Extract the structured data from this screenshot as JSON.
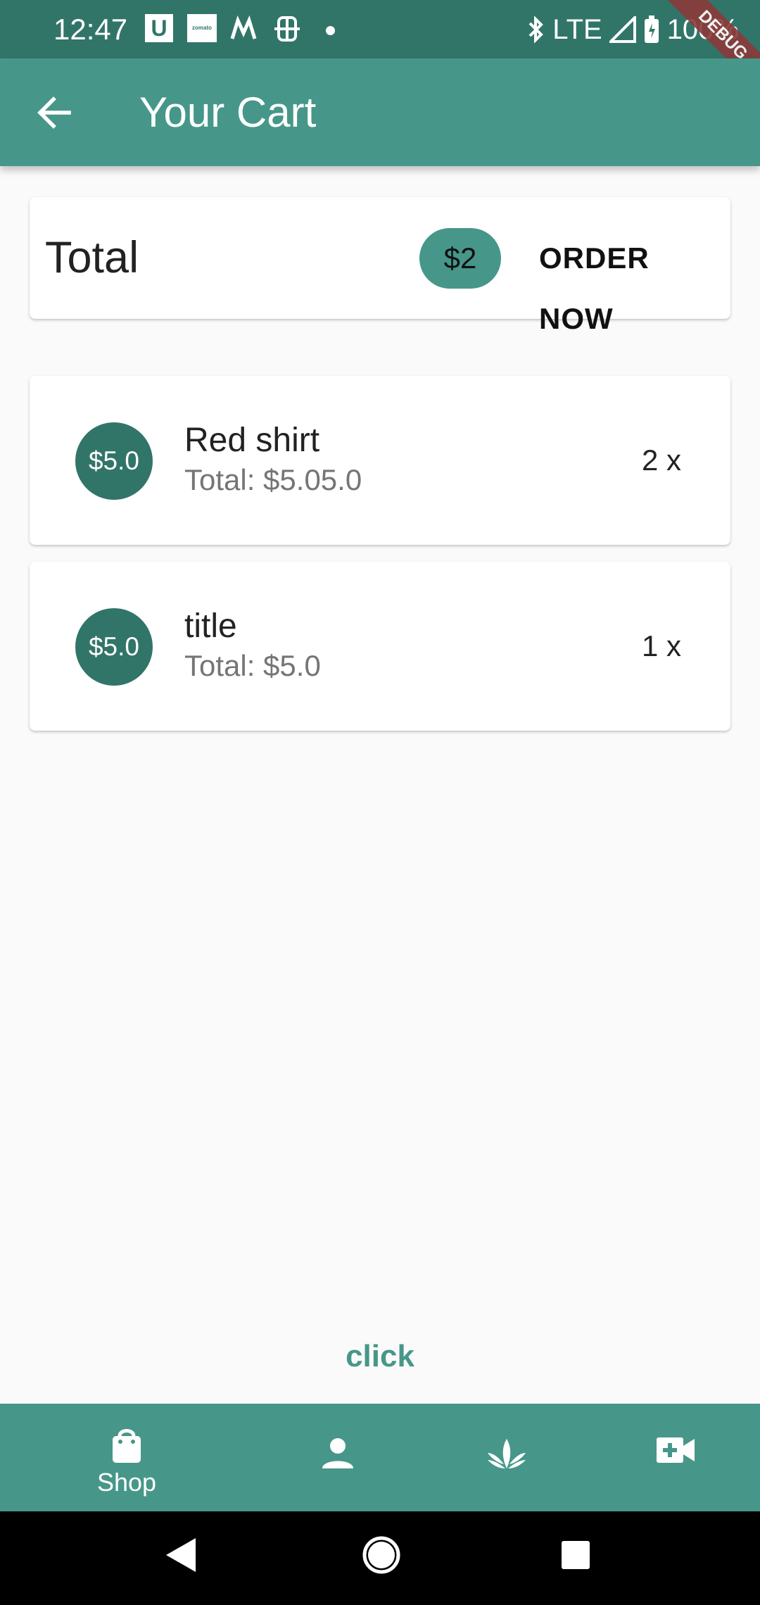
{
  "status_bar": {
    "time": "12:47",
    "network": "LTE",
    "battery": "100%",
    "debug_banner": "DEBUG",
    "notif_u": "U",
    "notif_zomato": "zomato"
  },
  "app_bar": {
    "title": "Your Cart",
    "back_icon": "arrow-back-icon"
  },
  "total_card": {
    "label": "Total",
    "amount": "$2",
    "order_button": "ORDER NOW"
  },
  "cart_items": [
    {
      "price": "$5.0",
      "title": "Red shirt",
      "subtitle": "Total: $5.05.0",
      "quantity": "2 x"
    },
    {
      "price": "$5.0",
      "title": "title",
      "subtitle": "Total: $5.0",
      "quantity": "1 x"
    }
  ],
  "footer_link": "click",
  "bottom_nav": {
    "items": [
      {
        "label": "Shop",
        "icon": "shopping-bag-icon"
      },
      {
        "label": "",
        "icon": "person-icon"
      },
      {
        "label": "",
        "icon": "plant-icon"
      },
      {
        "label": "",
        "icon": "video-call-icon"
      }
    ]
  },
  "colors": {
    "app_bar": "#469789",
    "status_bar": "#317569",
    "avatar": "#317569",
    "accent": "#469789",
    "background": "#fafafa"
  }
}
